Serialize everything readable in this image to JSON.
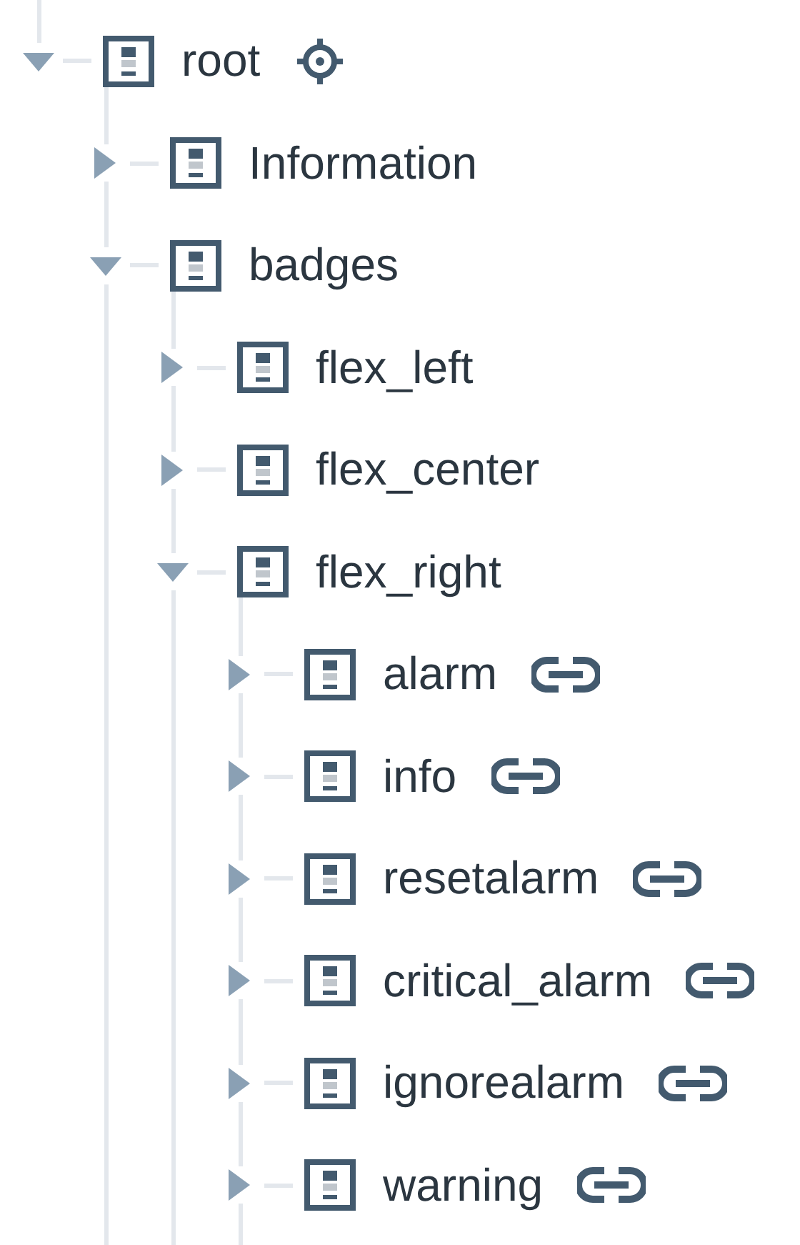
{
  "tree": [
    {
      "label": "root",
      "expanded": true,
      "locator": true,
      "linked": false,
      "children": [
        {
          "label": "Information",
          "expanded": false,
          "locator": false,
          "linked": false
        },
        {
          "label": "badges",
          "expanded": true,
          "locator": false,
          "linked": false,
          "children": [
            {
              "label": "flex_left",
              "expanded": false,
              "locator": false,
              "linked": false
            },
            {
              "label": "flex_center",
              "expanded": false,
              "locator": false,
              "linked": false
            },
            {
              "label": "flex_right",
              "expanded": true,
              "locator": false,
              "linked": false,
              "children": [
                {
                  "label": "alarm",
                  "expanded": false,
                  "locator": false,
                  "linked": true
                },
                {
                  "label": "info",
                  "expanded": false,
                  "locator": false,
                  "linked": true
                },
                {
                  "label": "resetalarm",
                  "expanded": false,
                  "locator": false,
                  "linked": true
                },
                {
                  "label": "critical_alarm",
                  "expanded": false,
                  "locator": false,
                  "linked": true
                },
                {
                  "label": "ignorealarm",
                  "expanded": false,
                  "locator": false,
                  "linked": true
                },
                {
                  "label": "warning",
                  "expanded": false,
                  "locator": false,
                  "linked": true
                }
              ]
            }
          ]
        }
      ]
    }
  ]
}
